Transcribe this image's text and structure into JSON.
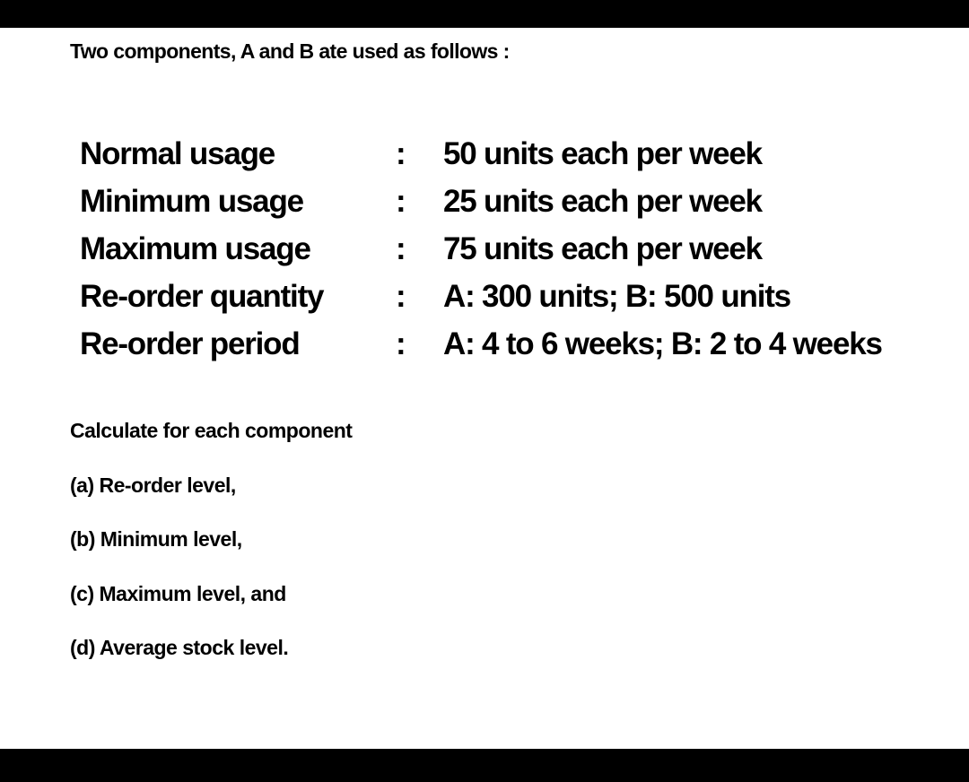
{
  "intro": "Two components, A and B ate used as follows :",
  "usage_rows": [
    {
      "label": "Normal usage",
      "separator": ":",
      "value": "50 units each per week"
    },
    {
      "label": "Minimum usage",
      "separator": ":",
      "value": "25 units each per week"
    },
    {
      "label": "Maximum usage",
      "separator": ":",
      "value": "75 units each per week"
    },
    {
      "label": "Re-order quantity",
      "separator": ":",
      "value": "A: 300 units; B: 500 units"
    },
    {
      "label": "Re-order period",
      "separator": ":",
      "value": "A: 4 to 6 weeks; B: 2 to 4 weeks"
    }
  ],
  "tasks": {
    "heading": "Calculate for each component",
    "items": [
      "(a) Re-order level,",
      "(b) Minimum level,",
      "(c) Maximum level, and",
      "(d) Average stock level."
    ]
  }
}
